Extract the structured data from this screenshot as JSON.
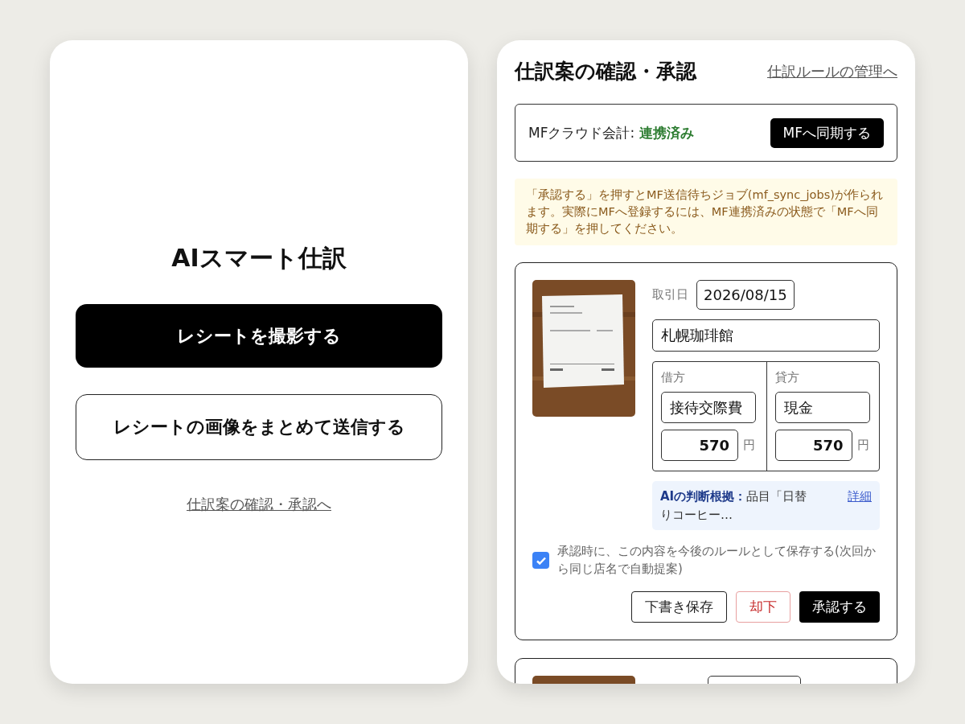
{
  "home": {
    "title": "AIスマート仕訳",
    "buttons": [
      {
        "label": "レシートを撮影する",
        "kind": "primary"
      },
      {
        "label": "レシートの画像をまとめて送信する",
        "kind": "secondary"
      }
    ],
    "link": "仕訳案の確認・承認へ"
  },
  "review": {
    "title": "仕訳案の確認・承認",
    "rules_link": "仕訳ルールの管理へ",
    "integration": {
      "label": "MFクラウド会計:",
      "status": "連携済み",
      "connected": true,
      "sync_button": "MFへ同期する"
    },
    "notice": "「承認する」を押すとMF送信待ちジョブ(mf_sync_jobs)が作られます。実際にMFへ登録するには、MF連携済みの状態で「MFへ同期する」を押してください。",
    "entries": [
      {
        "kind": "full",
        "date_label": "取引日",
        "date": "2026/08/15",
        "store": "札幌珈琲館",
        "debit": {
          "label": "借方",
          "account": "接待交際費",
          "amount": "570",
          "unit": "円"
        },
        "credit": {
          "label": "貸方",
          "account": "現金",
          "amount": "570",
          "unit": "円"
        },
        "reason": "**AIの判断根拠：**品目「日替りコーヒー…",
        "reason_link": "詳細",
        "save_rule": {
          "label": "承認時に、この内容を今後のルールとして保存する(次回から同じ店名で自動提案)",
          "checked": true
        },
        "actions": [
          {
            "label": "下書き保存",
            "kind": "outline"
          },
          {
            "label": "却下",
            "kind": "danger"
          },
          {
            "label": "承認する",
            "kind": "primary"
          }
        ]
      },
      {
        "kind": "cut"
      }
    ]
  }
}
